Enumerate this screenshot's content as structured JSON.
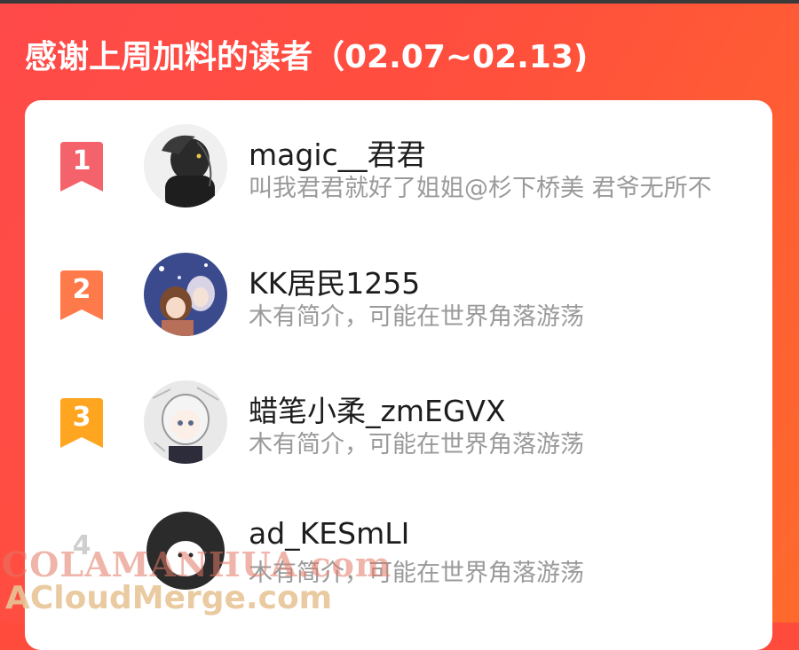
{
  "header": {
    "title": "感谢上周加料的读者（02.07~02.13)"
  },
  "readers": [
    {
      "rank": "1",
      "name": "magic__君君",
      "bio": "叫我君君就好了姐姐@杉下桥美 君爷无所不",
      "badge_color": "#f4636b"
    },
    {
      "rank": "2",
      "name": "KK居民1255",
      "bio": "木有简介，可能在世界角落游荡",
      "badge_color": "#ff7a4a"
    },
    {
      "rank": "3",
      "name": "蜡笔小柔_zmEGVX",
      "bio": "木有简介，可能在世界角落游荡",
      "badge_color": "#ffa51f"
    },
    {
      "rank": "4",
      "name": "ad_KESmLI",
      "bio": "木有简介，可能在世界角落游荡",
      "badge_color": "#cfcfcf"
    }
  ],
  "watermark": {
    "line1": "COLAMANHUA.com",
    "line2": "ACloudMerge.com"
  },
  "colors": {
    "background": "#ff4b3c",
    "card": "#ffffff"
  }
}
